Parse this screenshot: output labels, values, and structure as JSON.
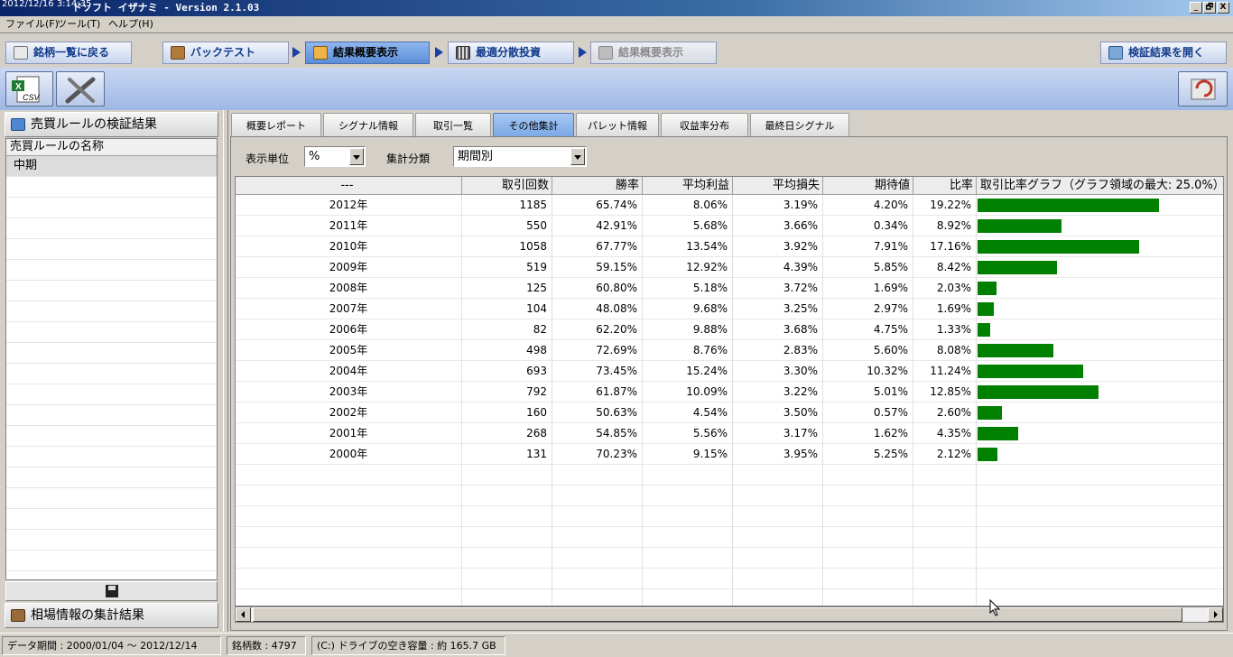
{
  "window": {
    "timestamp": "2012/12/16 3:14:35",
    "title": "ドソフト イザナミ - Version 2.1.03",
    "controls": [
      "_",
      "🗗",
      "X"
    ]
  },
  "menu": [
    "ファイル(F)",
    "ツール(T)",
    "ヘルプ(H)"
  ],
  "nav": {
    "back_to_list": "銘柄一覧に戻る",
    "backtest": "バックテスト",
    "summary": "結果概要表示",
    "optimal_allocation": "最適分散投資",
    "summary2": "結果概要表示",
    "open_results": "検証結果を開く"
  },
  "toolbar": {
    "csv_label": "CSV",
    "accent": "#1f7a34"
  },
  "left": {
    "rules_header": "売買ルールの検証結果",
    "rules_col": "売買ルールの名称",
    "rules": [
      "中期"
    ],
    "market_header": "相場情報の集計結果"
  },
  "tabs": [
    "概要レポート",
    "シグナル情報",
    "取引一覧",
    "その他集計",
    "パレット情報",
    "収益率分布",
    "最終日シグナル"
  ],
  "active_tab": 3,
  "filters": {
    "unit_label": "表示単位",
    "unit_value": "%",
    "category_label": "集計分類",
    "category_value": "期間別"
  },
  "table": {
    "columns": [
      "---",
      "取引回数",
      "勝率",
      "平均利益",
      "平均損失",
      "期待値",
      "比率",
      "取引比率グラフ（グラフ領域の最大: 25.0%）"
    ],
    "bar_color": "#008000",
    "graph_max_ratio": 25.0,
    "rows": [
      {
        "period": "2012年",
        "trades": "1185",
        "win_rate": "65.74%",
        "avg_profit": "8.06%",
        "avg_loss": "3.19%",
        "expectancy": "4.20%",
        "ratio": "19.22%",
        "ratio_value": 19.22
      },
      {
        "period": "2011年",
        "trades": "550",
        "win_rate": "42.91%",
        "avg_profit": "5.68%",
        "avg_loss": "3.66%",
        "expectancy": "0.34%",
        "ratio": "8.92%",
        "ratio_value": 8.92
      },
      {
        "period": "2010年",
        "trades": "1058",
        "win_rate": "67.77%",
        "avg_profit": "13.54%",
        "avg_loss": "3.92%",
        "expectancy": "7.91%",
        "ratio": "17.16%",
        "ratio_value": 17.16
      },
      {
        "period": "2009年",
        "trades": "519",
        "win_rate": "59.15%",
        "avg_profit": "12.92%",
        "avg_loss": "4.39%",
        "expectancy": "5.85%",
        "ratio": "8.42%",
        "ratio_value": 8.42
      },
      {
        "period": "2008年",
        "trades": "125",
        "win_rate": "60.80%",
        "avg_profit": "5.18%",
        "avg_loss": "3.72%",
        "expectancy": "1.69%",
        "ratio": "2.03%",
        "ratio_value": 2.03
      },
      {
        "period": "2007年",
        "trades": "104",
        "win_rate": "48.08%",
        "avg_profit": "9.68%",
        "avg_loss": "3.25%",
        "expectancy": "2.97%",
        "ratio": "1.69%",
        "ratio_value": 1.69
      },
      {
        "period": "2006年",
        "trades": "82",
        "win_rate": "62.20%",
        "avg_profit": "9.88%",
        "avg_loss": "3.68%",
        "expectancy": "4.75%",
        "ratio": "1.33%",
        "ratio_value": 1.33
      },
      {
        "period": "2005年",
        "trades": "498",
        "win_rate": "72.69%",
        "avg_profit": "8.76%",
        "avg_loss": "2.83%",
        "expectancy": "5.60%",
        "ratio": "8.08%",
        "ratio_value": 8.08
      },
      {
        "period": "2004年",
        "trades": "693",
        "win_rate": "73.45%",
        "avg_profit": "15.24%",
        "avg_loss": "3.30%",
        "expectancy": "10.32%",
        "ratio": "11.24%",
        "ratio_value": 11.24
      },
      {
        "period": "2003年",
        "trades": "792",
        "win_rate": "61.87%",
        "avg_profit": "10.09%",
        "avg_loss": "3.22%",
        "expectancy": "5.01%",
        "ratio": "12.85%",
        "ratio_value": 12.85
      },
      {
        "period": "2002年",
        "trades": "160",
        "win_rate": "50.63%",
        "avg_profit": "4.54%",
        "avg_loss": "3.50%",
        "expectancy": "0.57%",
        "ratio": "2.60%",
        "ratio_value": 2.6
      },
      {
        "period": "2001年",
        "trades": "268",
        "win_rate": "54.85%",
        "avg_profit": "5.56%",
        "avg_loss": "3.17%",
        "expectancy": "1.62%",
        "ratio": "4.35%",
        "ratio_value": 4.35
      },
      {
        "period": "2000年",
        "trades": "131",
        "win_rate": "70.23%",
        "avg_profit": "9.15%",
        "avg_loss": "3.95%",
        "expectancy": "5.25%",
        "ratio": "2.12%",
        "ratio_value": 2.12
      }
    ]
  },
  "status": {
    "data_period": "データ期間 : 2000/01/04 〜 2012/12/14",
    "stock_count": "銘柄数 : 4797",
    "drive_space": "(C:) ドライブの空き容量 : 約 165.7 GB"
  }
}
